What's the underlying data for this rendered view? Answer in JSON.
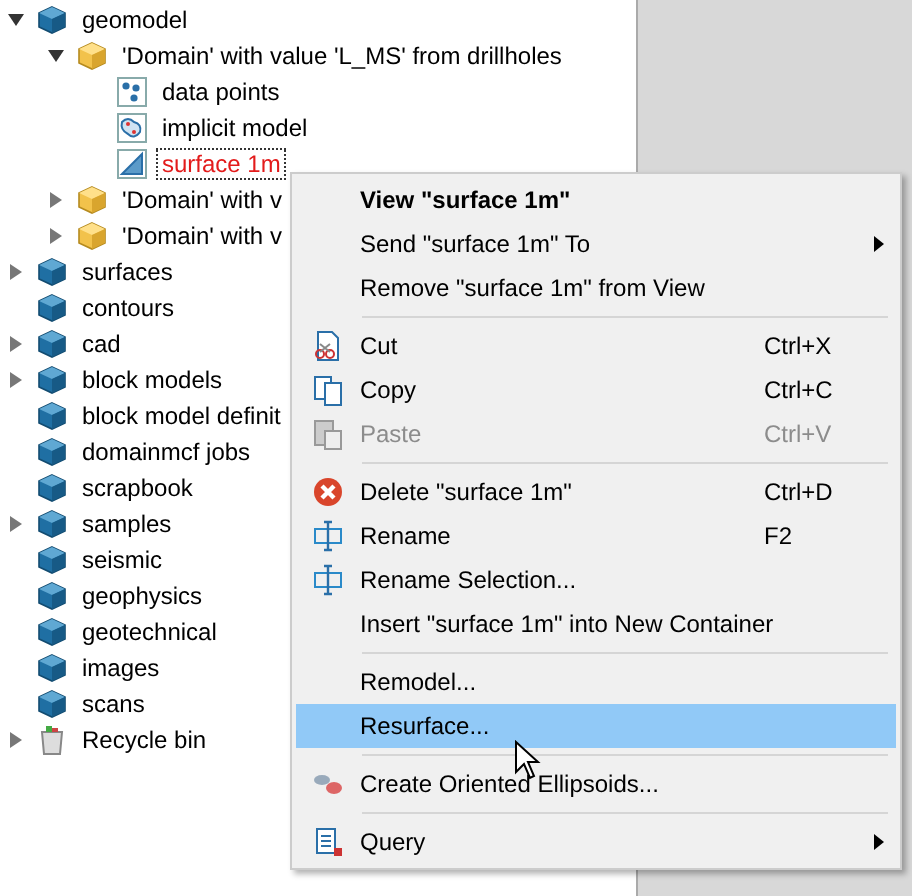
{
  "tree": [
    {
      "label": "geomodel",
      "kind": "cube",
      "expanded": true,
      "selected": false,
      "children": [
        {
          "label": "'Domain' with value 'L_MS' from drillholes",
          "kind": "yellow-cube",
          "expanded": true,
          "selected": false,
          "children": [
            {
              "label": "data points",
              "kind": "points",
              "selected": false
            },
            {
              "label": "implicit model",
              "kind": "implicit",
              "selected": false
            },
            {
              "label": "surface 1m",
              "kind": "surface",
              "selected": true
            }
          ]
        },
        {
          "label": "'Domain' with v",
          "kind": "yellow-cube",
          "expanded": false,
          "selected": false
        },
        {
          "label": "'Domain' with v",
          "kind": "yellow-cube",
          "expanded": false,
          "selected": false
        }
      ]
    },
    {
      "label": "surfaces",
      "kind": "cube",
      "expanded": false,
      "selected": false
    },
    {
      "label": "contours",
      "kind": "cube",
      "selected": false
    },
    {
      "label": "cad",
      "kind": "cube",
      "expanded": false,
      "selected": false
    },
    {
      "label": "block models",
      "kind": "cube",
      "expanded": false,
      "selected": false
    },
    {
      "label": "block model definit",
      "kind": "cube",
      "selected": false
    },
    {
      "label": "domainmcf jobs",
      "kind": "cube",
      "selected": false
    },
    {
      "label": "scrapbook",
      "kind": "cube",
      "selected": false
    },
    {
      "label": "samples",
      "kind": "cube",
      "expanded": false,
      "selected": false
    },
    {
      "label": "seismic",
      "kind": "cube",
      "selected": false
    },
    {
      "label": "geophysics",
      "kind": "cube",
      "selected": false
    },
    {
      "label": "geotechnical",
      "kind": "cube",
      "selected": false
    },
    {
      "label": "images",
      "kind": "cube",
      "selected": false
    },
    {
      "label": "scans",
      "kind": "cube",
      "selected": false
    },
    {
      "label": "Recycle bin",
      "kind": "recycle",
      "expanded": false,
      "selected": false
    }
  ],
  "context_menu": [
    {
      "kind": "text",
      "label": "View \"surface 1m\"",
      "default": true,
      "disabled": false,
      "selected": false,
      "submenu": false
    },
    {
      "kind": "text",
      "label": "Send \"surface 1m\" To",
      "default": false,
      "disabled": false,
      "selected": false,
      "submenu": true
    },
    {
      "kind": "text",
      "label": "Remove \"surface 1m\" from View",
      "default": false,
      "disabled": false,
      "selected": false,
      "submenu": false
    },
    {
      "kind": "separator"
    },
    {
      "kind": "cut",
      "label": "Cut",
      "shortcut": "Ctrl+X",
      "default": false,
      "disabled": false,
      "selected": false,
      "submenu": false
    },
    {
      "kind": "copy",
      "label": "Copy",
      "shortcut": "Ctrl+C",
      "default": false,
      "disabled": false,
      "selected": false,
      "submenu": false
    },
    {
      "kind": "paste",
      "label": "Paste",
      "shortcut": "Ctrl+V",
      "default": false,
      "disabled": true,
      "selected": false,
      "submenu": false
    },
    {
      "kind": "separator"
    },
    {
      "kind": "delete",
      "label": "Delete \"surface 1m\"",
      "shortcut": "Ctrl+D",
      "default": false,
      "disabled": false,
      "selected": false,
      "submenu": false
    },
    {
      "kind": "rename",
      "label": "Rename",
      "shortcut": "F2",
      "default": false,
      "disabled": false,
      "selected": false,
      "submenu": false
    },
    {
      "kind": "rename",
      "label": "Rename Selection...",
      "default": false,
      "disabled": false,
      "selected": false,
      "submenu": false
    },
    {
      "kind": "text",
      "label": "Insert \"surface 1m\" into New Container",
      "default": false,
      "disabled": false,
      "selected": false,
      "submenu": false
    },
    {
      "kind": "separator"
    },
    {
      "kind": "text",
      "label": "Remodel...",
      "default": false,
      "disabled": false,
      "selected": false,
      "submenu": false
    },
    {
      "kind": "text",
      "label": "Resurface...",
      "default": false,
      "disabled": false,
      "selected": true,
      "submenu": false
    },
    {
      "kind": "separator"
    },
    {
      "kind": "ellipsoids",
      "label": "Create Oriented Ellipsoids...",
      "default": false,
      "disabled": false,
      "selected": false,
      "submenu": false
    },
    {
      "kind": "separator"
    },
    {
      "kind": "query",
      "label": "Query",
      "default": false,
      "disabled": false,
      "selected": false,
      "submenu": true
    }
  ]
}
